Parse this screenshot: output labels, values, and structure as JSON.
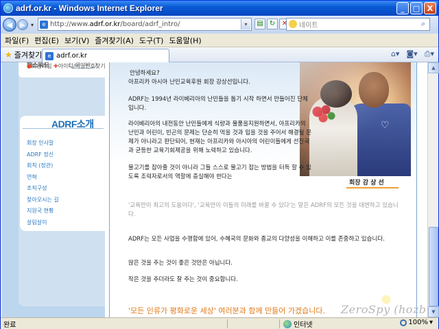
{
  "window": {
    "title": "adrf.or.kr - Windows Internet Explorer",
    "minimize": "_",
    "maximize": "□",
    "close": "X"
  },
  "address": {
    "url_prefix": "http://www.",
    "url_domain": "adrf.or.kr",
    "url_path": "/board/adrf_intro/"
  },
  "search": {
    "placeholder": "네이트"
  },
  "menu": [
    "파일(F)",
    "편집(E)",
    "보기(V)",
    "즐겨찾기(A)",
    "도구(T)",
    "도움말(H)"
  ],
  "favorites": {
    "label": "즐겨찾기"
  },
  "tab": {
    "label": "adrf.or.kr"
  },
  "page": {
    "login": {
      "password_label": "패스워드",
      "login_button": "로그인",
      "join": "회원가입",
      "find": "아이디/비밀번호찾기"
    },
    "about_title": "ADRF소개",
    "submenu": [
      "회장 인사말",
      "ADRF 정신",
      "회칙 (정관)",
      "연혁",
      "조직구성",
      "찾아오시는 길",
      "지원국 현황",
      "살림살이"
    ],
    "greeting": "안녕하세요?",
    "intro": "아프리카 아시아 난민교육후원 회장 강상선입니다.",
    "p1": "ADRF는 1994년 라이베리아의 난민들을 돕기 시작 하면서 만들어진 단체입니다.",
    "p2": "라이베리아의 내전동안 난민들에게 식량과 물품을지원하면서, 아프리카의 난민과 어린이, 빈곤의 문제는 단순히 먹을 것과 입을 것을 주어서 해결될 문제가 아니라고 판단되어, 현재는 아프리카와 아시아의 어린이들에게 선진국과 균등한 교육기회제공을 위해 노력하고 있습니다.",
    "p3": "물고기를 잡아줄 것이 아니라 그들 스스로 물고기 잡는 방법을 터득 할 수 있도록 조력자로서의 역할에 충실해야 한다는",
    "caption_role": "회장",
    "caption_name": "강 상 선",
    "quote": "'교육만이 최고의 도움이다', '교육만이 이들의 미래를 바꿀 수 있다'는 말은 ADRF의 모든 것을 대변하고 있습니다.",
    "p4": "ADRF는 모든 사업을 수행함에 있어, 수혜국의 문화와 종교의 다양성을 이해하고 이를 존중하고 있습니다.",
    "p5": "많은 것을 주는 것이 좋은 것만은 아닙니다.",
    "p6": "작은 것을 주더라도 잘 주는 것이 중요합니다.",
    "slogan": "'모든 인류가 평화로운 세상' 여러분과 함께 만들어 가겠습니다.",
    "watermark": "ZeroSpy (hozbu.ne.kr)"
  },
  "status": {
    "left": "완료",
    "zone": "인터넷",
    "zoom": "100%"
  }
}
